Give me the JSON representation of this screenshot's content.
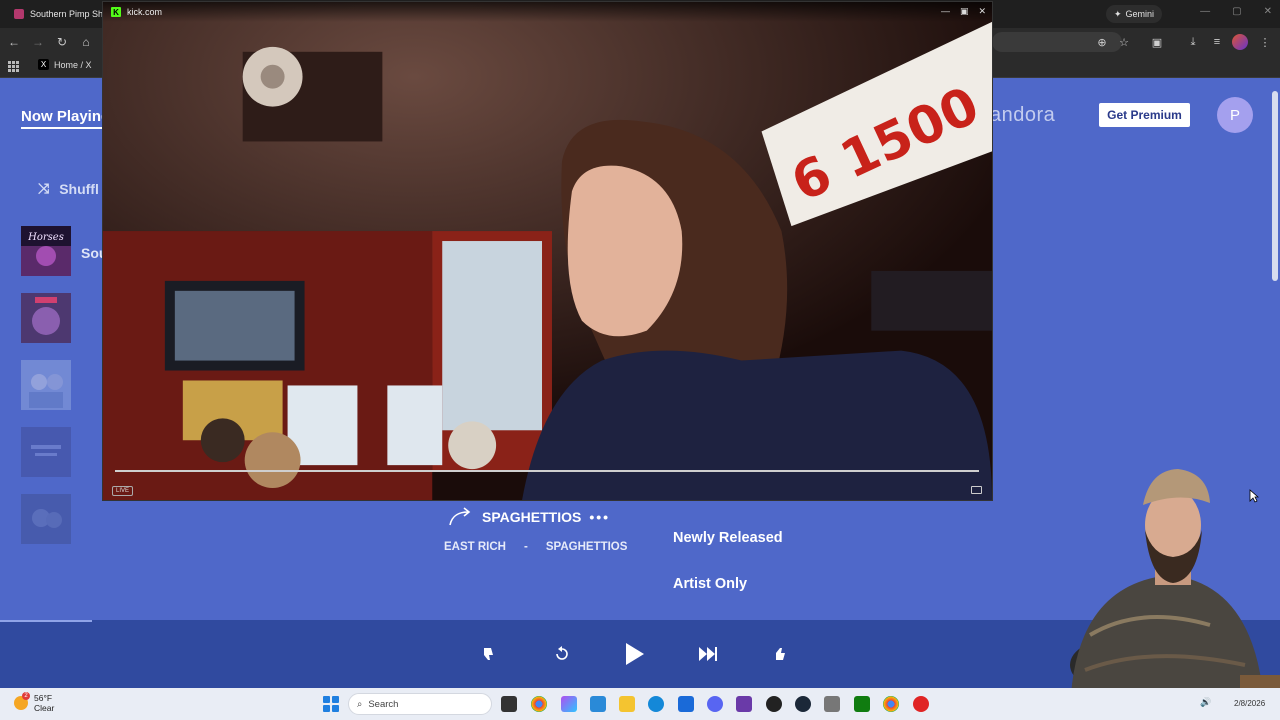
{
  "browser": {
    "tab_title": "Southern Pimp Shit -",
    "gemini_label": "Gemini",
    "bookmark_x_label": "Home / X"
  },
  "video_window": {
    "title": "kick.com",
    "live_badge": "LIVE"
  },
  "pandora": {
    "now_playing_label": "Now Playing",
    "shuffle_label": "Shuffl",
    "station_label": "Sou",
    "logo_text": "andora",
    "premium_button": "Get Premium",
    "avatar_initial": "P",
    "track": {
      "title": "SPAGHETTIOS",
      "more_dots": "•••",
      "artist": "EAST RICH",
      "separator": "-",
      "album": "SPAGHETTIOS"
    },
    "modes": [
      "Newly Released",
      "Artist Only"
    ],
    "thumbnails": [
      {
        "name": "Horses",
        "color": "#2a1a3a"
      },
      {
        "name": "thumb-2",
        "color": "#5b3f7a"
      },
      {
        "name": "thumb-3",
        "color": "#7088c8"
      },
      {
        "name": "thumb-4",
        "color": "#5a64a8"
      },
      {
        "name": "thumb-5",
        "color": "#6a7cc2"
      }
    ],
    "thumb_1_text": "Horses"
  },
  "taskbar": {
    "temperature": "56°F",
    "condition": "Clear",
    "search_placeholder": "Search",
    "date": "2/8/2026"
  },
  "colors": {
    "page_bg": "#4f68c9",
    "player_bg": "#304a9f",
    "taskbar_bg": "#e9edf5"
  }
}
